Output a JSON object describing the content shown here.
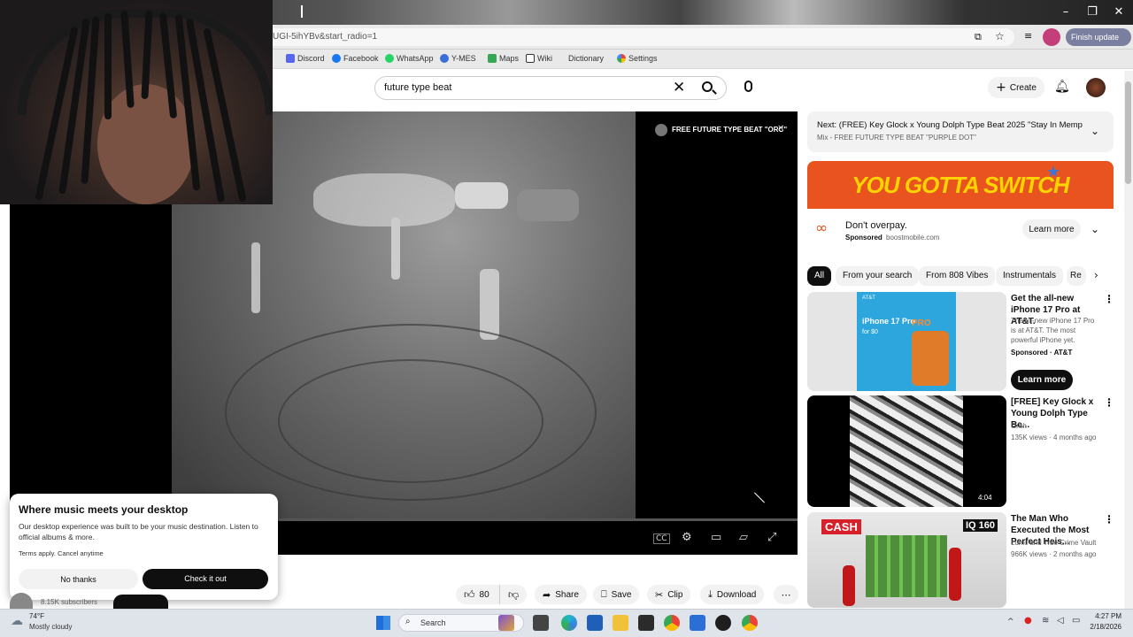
{
  "browser": {
    "url": "UGI-5ihYBv&start_radio=1",
    "update_label": "Finish update",
    "bookmarks": [
      "Discord",
      "Facebook",
      "WhatsApp",
      "Y-MES",
      "Maps",
      "Wiki",
      "Dictionary",
      "Settings"
    ]
  },
  "youtube": {
    "search_query": "future type beat",
    "create_label": "Create"
  },
  "video": {
    "overlay_title": "FREE FUTURE TYPE BEAT \"ORC\""
  },
  "up_next": {
    "title": "Next: (FREE) Key Glock x Young Dolph Type Beat 2025 \"Stay In Memp...",
    "subtitle": "Mix - FREE FUTURE TYPE BEAT \"PURPLE DOT\""
  },
  "ad": {
    "banner": "YOU GOTTA SWITCH",
    "headline": "Don't overpay.",
    "sponsored": "Sponsored",
    "domain": "boostmobile.com",
    "cta": "Learn more"
  },
  "chips": [
    "All",
    "From your search",
    "From 808 Vibes",
    "Instrumentals",
    "Re"
  ],
  "recommendations": [
    {
      "title": "Get the all-new iPhone 17 Pro at AT&T.",
      "desc": "The all-new iPhone 17 Pro is at AT&T. The most powerful iPhone yet.",
      "meta": "Sponsored · AT&T",
      "cta": "Learn more",
      "thumb_text": "iPhone 17 Pro",
      "thumb_sub": "for $0",
      "thumb_brand": "AT&T",
      "thumb_word": "PRO"
    },
    {
      "title": "[FREE] Key Glock x Young Dolph Type Be...",
      "channel": "Grah",
      "meta": "135K views · 4 months ago",
      "duration": "4:04"
    },
    {
      "title": "The Man Who Executed the Most Perfect Heis...",
      "channel": "Lunic and True Crime Vault",
      "meta": "966K views · 2 months ago",
      "thumb_left": "CASH",
      "thumb_right": "IQ 160"
    }
  ],
  "popup": {
    "title": "Where music meets your desktop",
    "body": "Our desktop experience was built to be your music destination. Listen to official albums & more.",
    "terms": "Terms apply. Cancel anytime",
    "no_label": "No thanks",
    "yes_label": "Check it out"
  },
  "channel": {
    "subscribers": "8.15K subscribers"
  },
  "actions": {
    "likes": "80",
    "share": "Share",
    "save": "Save",
    "clip": "Clip",
    "download": "Download"
  },
  "taskbar": {
    "weather_temp": "74°F",
    "weather_desc": "Mostly cloudy",
    "search_label": "Search",
    "time": "4:27 PM",
    "date": "2/18/2026"
  }
}
